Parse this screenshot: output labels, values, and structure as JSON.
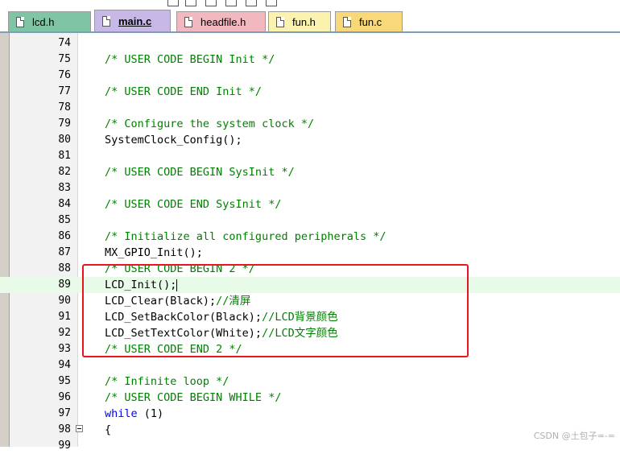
{
  "tabs": [
    {
      "label": "lcd.h",
      "color": "#7fc4a4",
      "active": false,
      "icon": "header-file-icon"
    },
    {
      "label": "main.c",
      "color": "#c8b8e8",
      "active": true,
      "icon": "source-file-icon"
    },
    {
      "label": "headfile.h",
      "color": "#f2b8c0",
      "active": false,
      "icon": "header-file-icon"
    },
    {
      "label": "fun.h",
      "color": "#fbf2b0",
      "active": false,
      "icon": "header-file-icon"
    },
    {
      "label": "fun.c",
      "color": "#f8d878",
      "active": false,
      "icon": "source-file-icon"
    }
  ],
  "editor": {
    "current_line": "89",
    "lines": [
      {
        "n": "74",
        "text": "",
        "type": "plain"
      },
      {
        "n": "75",
        "text": "/* USER CODE BEGIN Init */",
        "type": "comment"
      },
      {
        "n": "76",
        "text": "",
        "type": "plain"
      },
      {
        "n": "77",
        "text": "/* USER CODE END Init */",
        "type": "comment"
      },
      {
        "n": "78",
        "text": "",
        "type": "plain"
      },
      {
        "n": "79",
        "text": "/* Configure the system clock */",
        "type": "comment"
      },
      {
        "n": "80",
        "text": "SystemClock_Config();",
        "type": "plain"
      },
      {
        "n": "81",
        "text": "",
        "type": "plain"
      },
      {
        "n": "82",
        "text": "/* USER CODE BEGIN SysInit */",
        "type": "comment"
      },
      {
        "n": "83",
        "text": "",
        "type": "plain"
      },
      {
        "n": "84",
        "text": "/* USER CODE END SysInit */",
        "type": "comment"
      },
      {
        "n": "85",
        "text": "",
        "type": "plain"
      },
      {
        "n": "86",
        "text": "/* Initialize all configured peripherals */",
        "type": "comment"
      },
      {
        "n": "87",
        "text": "MX_GPIO_Init();",
        "type": "plain"
      },
      {
        "n": "88",
        "text": "/* USER CODE BEGIN 2 */",
        "type": "comment"
      },
      {
        "n": "89",
        "text": "LCD_Init();",
        "type": "plain"
      },
      {
        "n": "90",
        "text": "LCD_Clear(Black);",
        "type": "plain",
        "comment": "//清屏"
      },
      {
        "n": "91",
        "text": "LCD_SetBackColor(Black);",
        "type": "plain",
        "comment": "//LCD背景颜色"
      },
      {
        "n": "92",
        "text": "LCD_SetTextColor(White);",
        "type": "plain",
        "comment": "//LCD文字颜色"
      },
      {
        "n": "93",
        "text": "/* USER CODE END 2 */",
        "type": "comment"
      },
      {
        "n": "94",
        "text": "",
        "type": "plain"
      },
      {
        "n": "95",
        "text": "/* Infinite loop */",
        "type": "comment"
      },
      {
        "n": "96",
        "text": "/* USER CODE BEGIN WHILE */",
        "type": "comment"
      },
      {
        "n": "97",
        "text": "while",
        "type": "keyword",
        "rest": " (1)"
      },
      {
        "n": "98",
        "text": "{",
        "type": "plain",
        "fold": true
      },
      {
        "n": "99",
        "text": "",
        "type": "plain"
      }
    ]
  },
  "highlight_color": "#e8141e",
  "watermark": "CSDN @土包子=-="
}
